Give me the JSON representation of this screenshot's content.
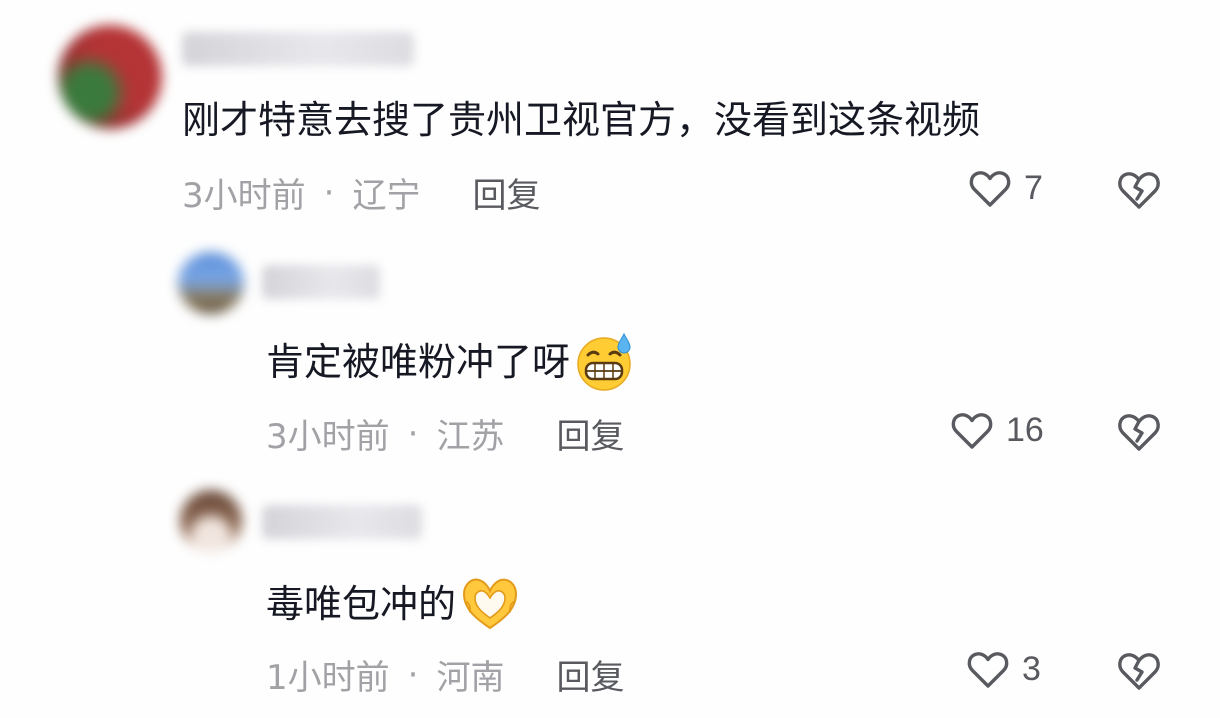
{
  "comments": [
    {
      "text": "刚才特意去搜了贵州卫视官方，没看到这条视频",
      "time": "3小时前",
      "separator": "·",
      "location": "辽宁",
      "reply_label": "回复",
      "like_count": "7"
    },
    {
      "text": "肯定被唯粉冲了呀",
      "emoji": "grinning-sweat-emoji",
      "time": "3小时前",
      "separator": "·",
      "location": "江苏",
      "reply_label": "回复",
      "like_count": "16"
    },
    {
      "text": "毒唯包冲的",
      "emoji": "heart-hands-emoji",
      "time": "1小时前",
      "separator": "·",
      "location": "河南",
      "reply_label": "回复",
      "like_count": "3"
    }
  ],
  "icons": {
    "like": "heart-outline-icon",
    "dislike": "broken-heart-icon"
  },
  "colors": {
    "text": "#161823",
    "meta": "#a1a1a6",
    "reply": "#595a5f",
    "icon": "#595a5f",
    "background": "#fefefe"
  }
}
